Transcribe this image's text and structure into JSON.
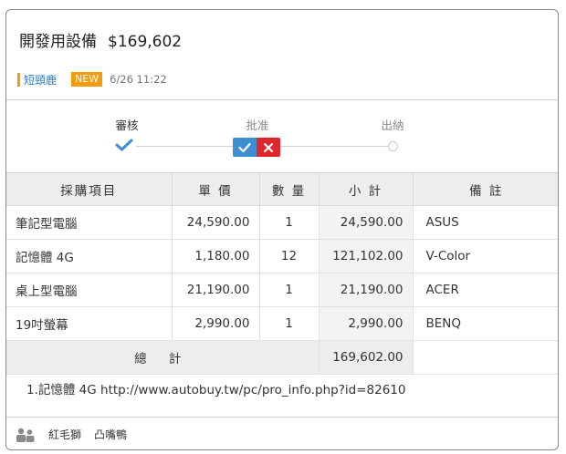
{
  "header": {
    "title": "開發用設備",
    "amount": "$169,602"
  },
  "meta": {
    "requester": "短頸鹿",
    "badge": "NEW",
    "time": "6/26 11:22",
    "accent_color": "#f39c12"
  },
  "workflow": {
    "steps": [
      {
        "label": "審核",
        "state": "done"
      },
      {
        "label": "批准",
        "state": "current"
      },
      {
        "label": "出納",
        "state": "pending"
      }
    ],
    "approve_icon": "check-icon",
    "reject_icon": "close-icon"
  },
  "table": {
    "headers": [
      "採購項目",
      "單 價",
      "數 量",
      "小 計",
      "備 註"
    ],
    "rows": [
      {
        "item": "筆記型電腦",
        "price": "24,590.00",
        "qty": "1",
        "subtotal": "24,590.00",
        "note": "ASUS"
      },
      {
        "item": "記憶體 4G",
        "price": "1,180.00",
        "qty": "12",
        "subtotal": "121,102.00",
        "note": "V-Color"
      },
      {
        "item": "桌上型電腦",
        "price": "21,190.00",
        "qty": "1",
        "subtotal": "21,190.00",
        "note": "ACER"
      },
      {
        "item": "19吋螢幕",
        "price": "2,990.00",
        "qty": "1",
        "subtotal": "2,990.00",
        "note": "BENQ"
      }
    ],
    "total_label": "總 計",
    "total_value": "169,602.00"
  },
  "remark": "1.記憶體 4G http://www.autobuy.tw/pc/pro_info.php?id=82610",
  "footer": {
    "icon": "people-icon",
    "people": [
      "紅毛獅",
      "凸嘴鴨"
    ]
  }
}
